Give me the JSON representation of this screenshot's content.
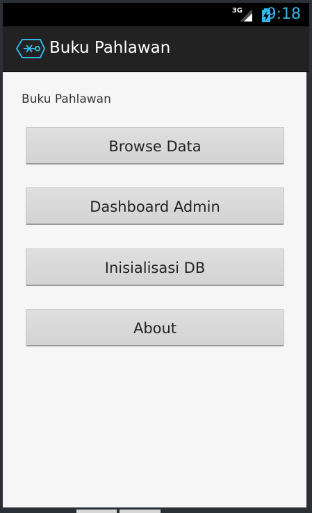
{
  "status_bar": {
    "network": "3G",
    "time": "9:18",
    "signal_icon": "signal-icon",
    "battery_icon": "battery-charging-icon",
    "time_color": "#33b5e5"
  },
  "action_bar": {
    "title": "Buku Pahlawan",
    "icon": "app-logo-icon"
  },
  "content": {
    "label": "Buku Pahlawan",
    "buttons": [
      "Browse Data",
      "Dashboard Admin",
      "Inisialisasi DB",
      "About"
    ]
  },
  "colors": {
    "status_bar": "#000000",
    "action_bar": "#222222",
    "accent": "#33b5e5",
    "content_background": "#f6f6f6",
    "button": "#d8d8d8"
  }
}
